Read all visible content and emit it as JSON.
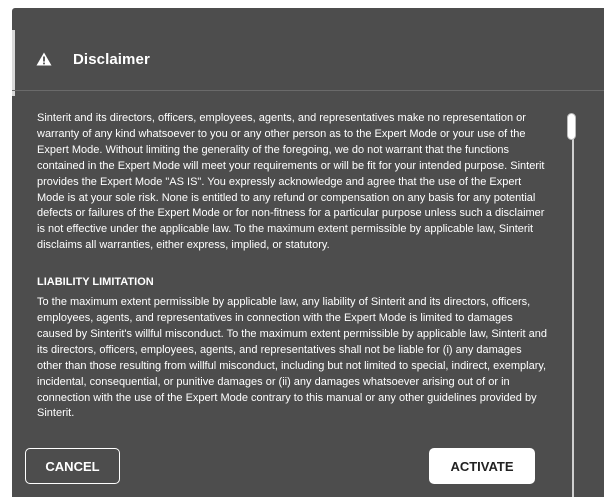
{
  "dialog": {
    "title": "Disclaimer",
    "icon": "warning-icon",
    "body_paragraph": "Sinterit and its directors, officers, employees, agents, and representatives make no representation or warranty of any kind whatsoever to you or any other person as to the Expert Mode or your use of the Expert Mode. Without limiting the generality of the foregoing, we do not warrant that the functions contained in the Expert Mode will meet your requirements or will be fit for your intended purpose. Sinterit provides the Expert Mode \"AS IS\". You expressly acknowledge and agree that the use of the Expert Mode is at your sole risk. None is entitled to any refund or compensation on any basis for any potential defects or failures of the Expert Mode or for non-fitness for a particular purpose unless such a disclaimer is not effective under the applicable law. To the maximum extent permissible by applicable law, Sinterit disclaims all warranties, either express, implied, or statutory.",
    "section_heading": "LIABILITY LIMITATION",
    "section_paragraph": "To the maximum extent permissible by applicable law, any liability of Sinterit and its directors, officers, employees, agents, and representatives in connection with the Expert Mode is limited to damages caused by Sinterit's willful misconduct. To the maximum extent permissible by applicable law, Sinterit and its directors, officers, employees, agents, and representatives shall not be liable for (i) any damages other than those resulting from willful misconduct, including but not limited to special, indirect, exemplary, incidental, consequential, or punitive damages or (ii) any damages whatsoever arising out of or in connection with the use of the Expert Mode contrary to this manual or any other guidelines provided by Sinterit.",
    "cancel_label": "CANCEL",
    "activate_label": "ACTIVATE"
  },
  "colors": {
    "dialog_background": "#4d4d4d",
    "text": "#ffffff",
    "primary_button": "#ffffff"
  }
}
